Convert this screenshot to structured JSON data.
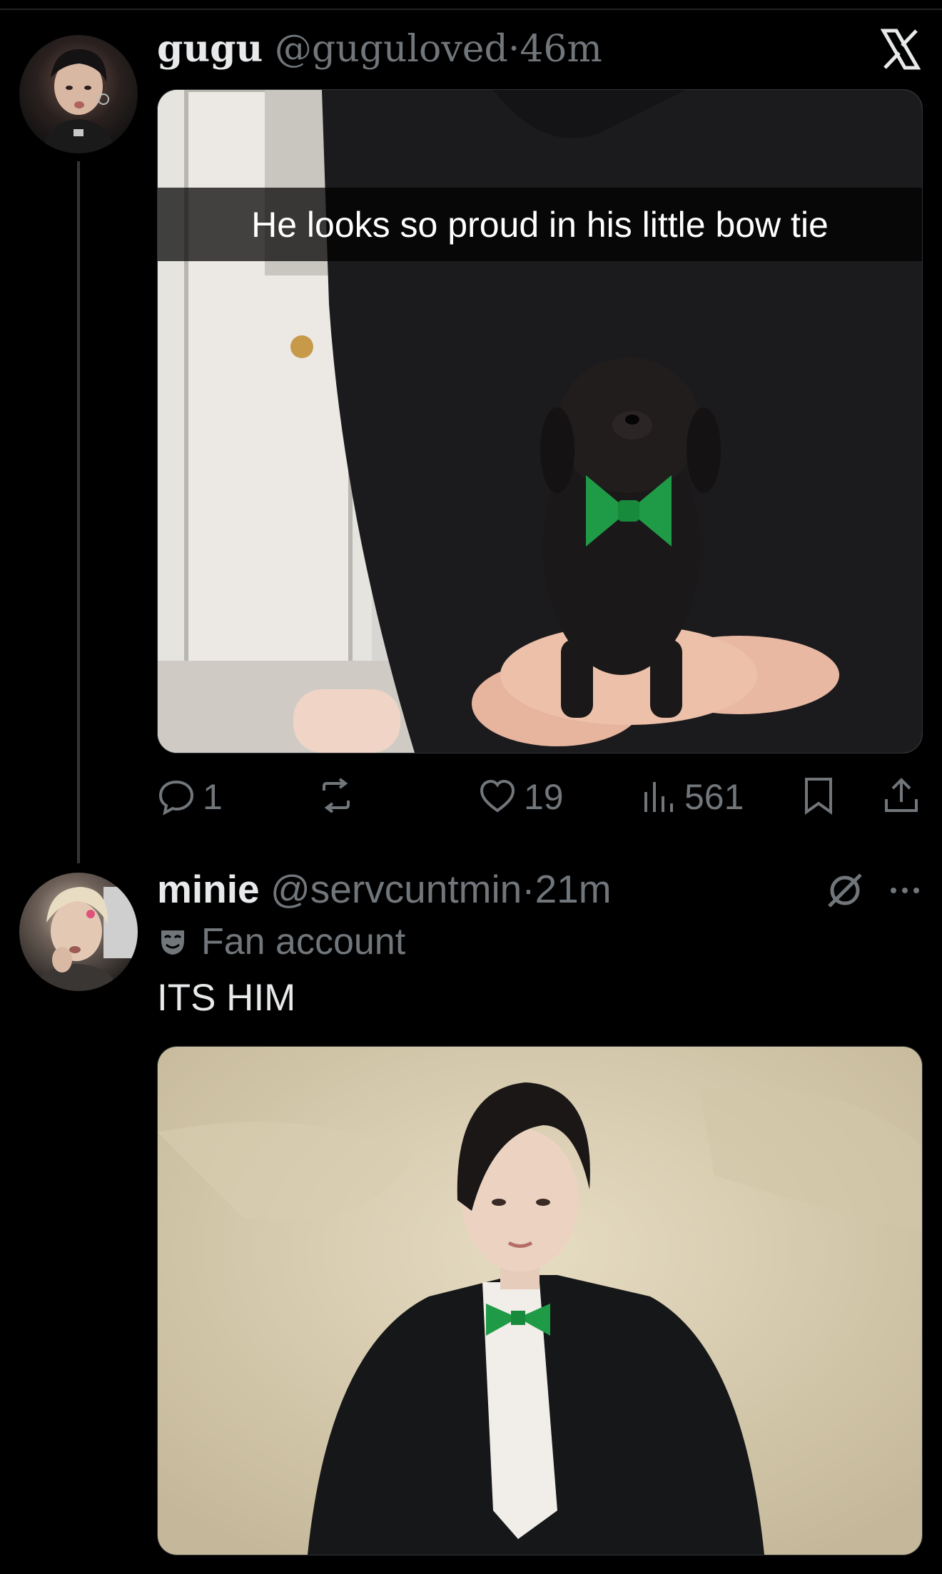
{
  "tweet1": {
    "name": "gugu",
    "handle": "@guguloved",
    "dot": "·",
    "time": "46m",
    "image_caption": "He looks so proud in his little bow tie",
    "replies": "1",
    "retweets": "",
    "likes": "19",
    "views": "561"
  },
  "tweet2": {
    "name": "minie",
    "handle": "@servcuntmin",
    "dot": "·",
    "time": "21m",
    "badge_label": "Fan account",
    "text": "ITS HIM"
  },
  "icons": {
    "close": "x-logo-icon",
    "reply": "speech-bubble-icon",
    "retweet": "retweet-icon",
    "like": "heart-icon",
    "views": "bar-chart-icon",
    "bookmark": "bookmark-icon",
    "share": "share-icon",
    "badge": "mask-icon",
    "grok": "slashed-circle-icon",
    "more": "ellipsis-icon"
  },
  "colors": {
    "background": "#000000",
    "text_primary": "#e7e9ea",
    "text_secondary": "#71767b",
    "bow_tie": "#1f9a46"
  }
}
